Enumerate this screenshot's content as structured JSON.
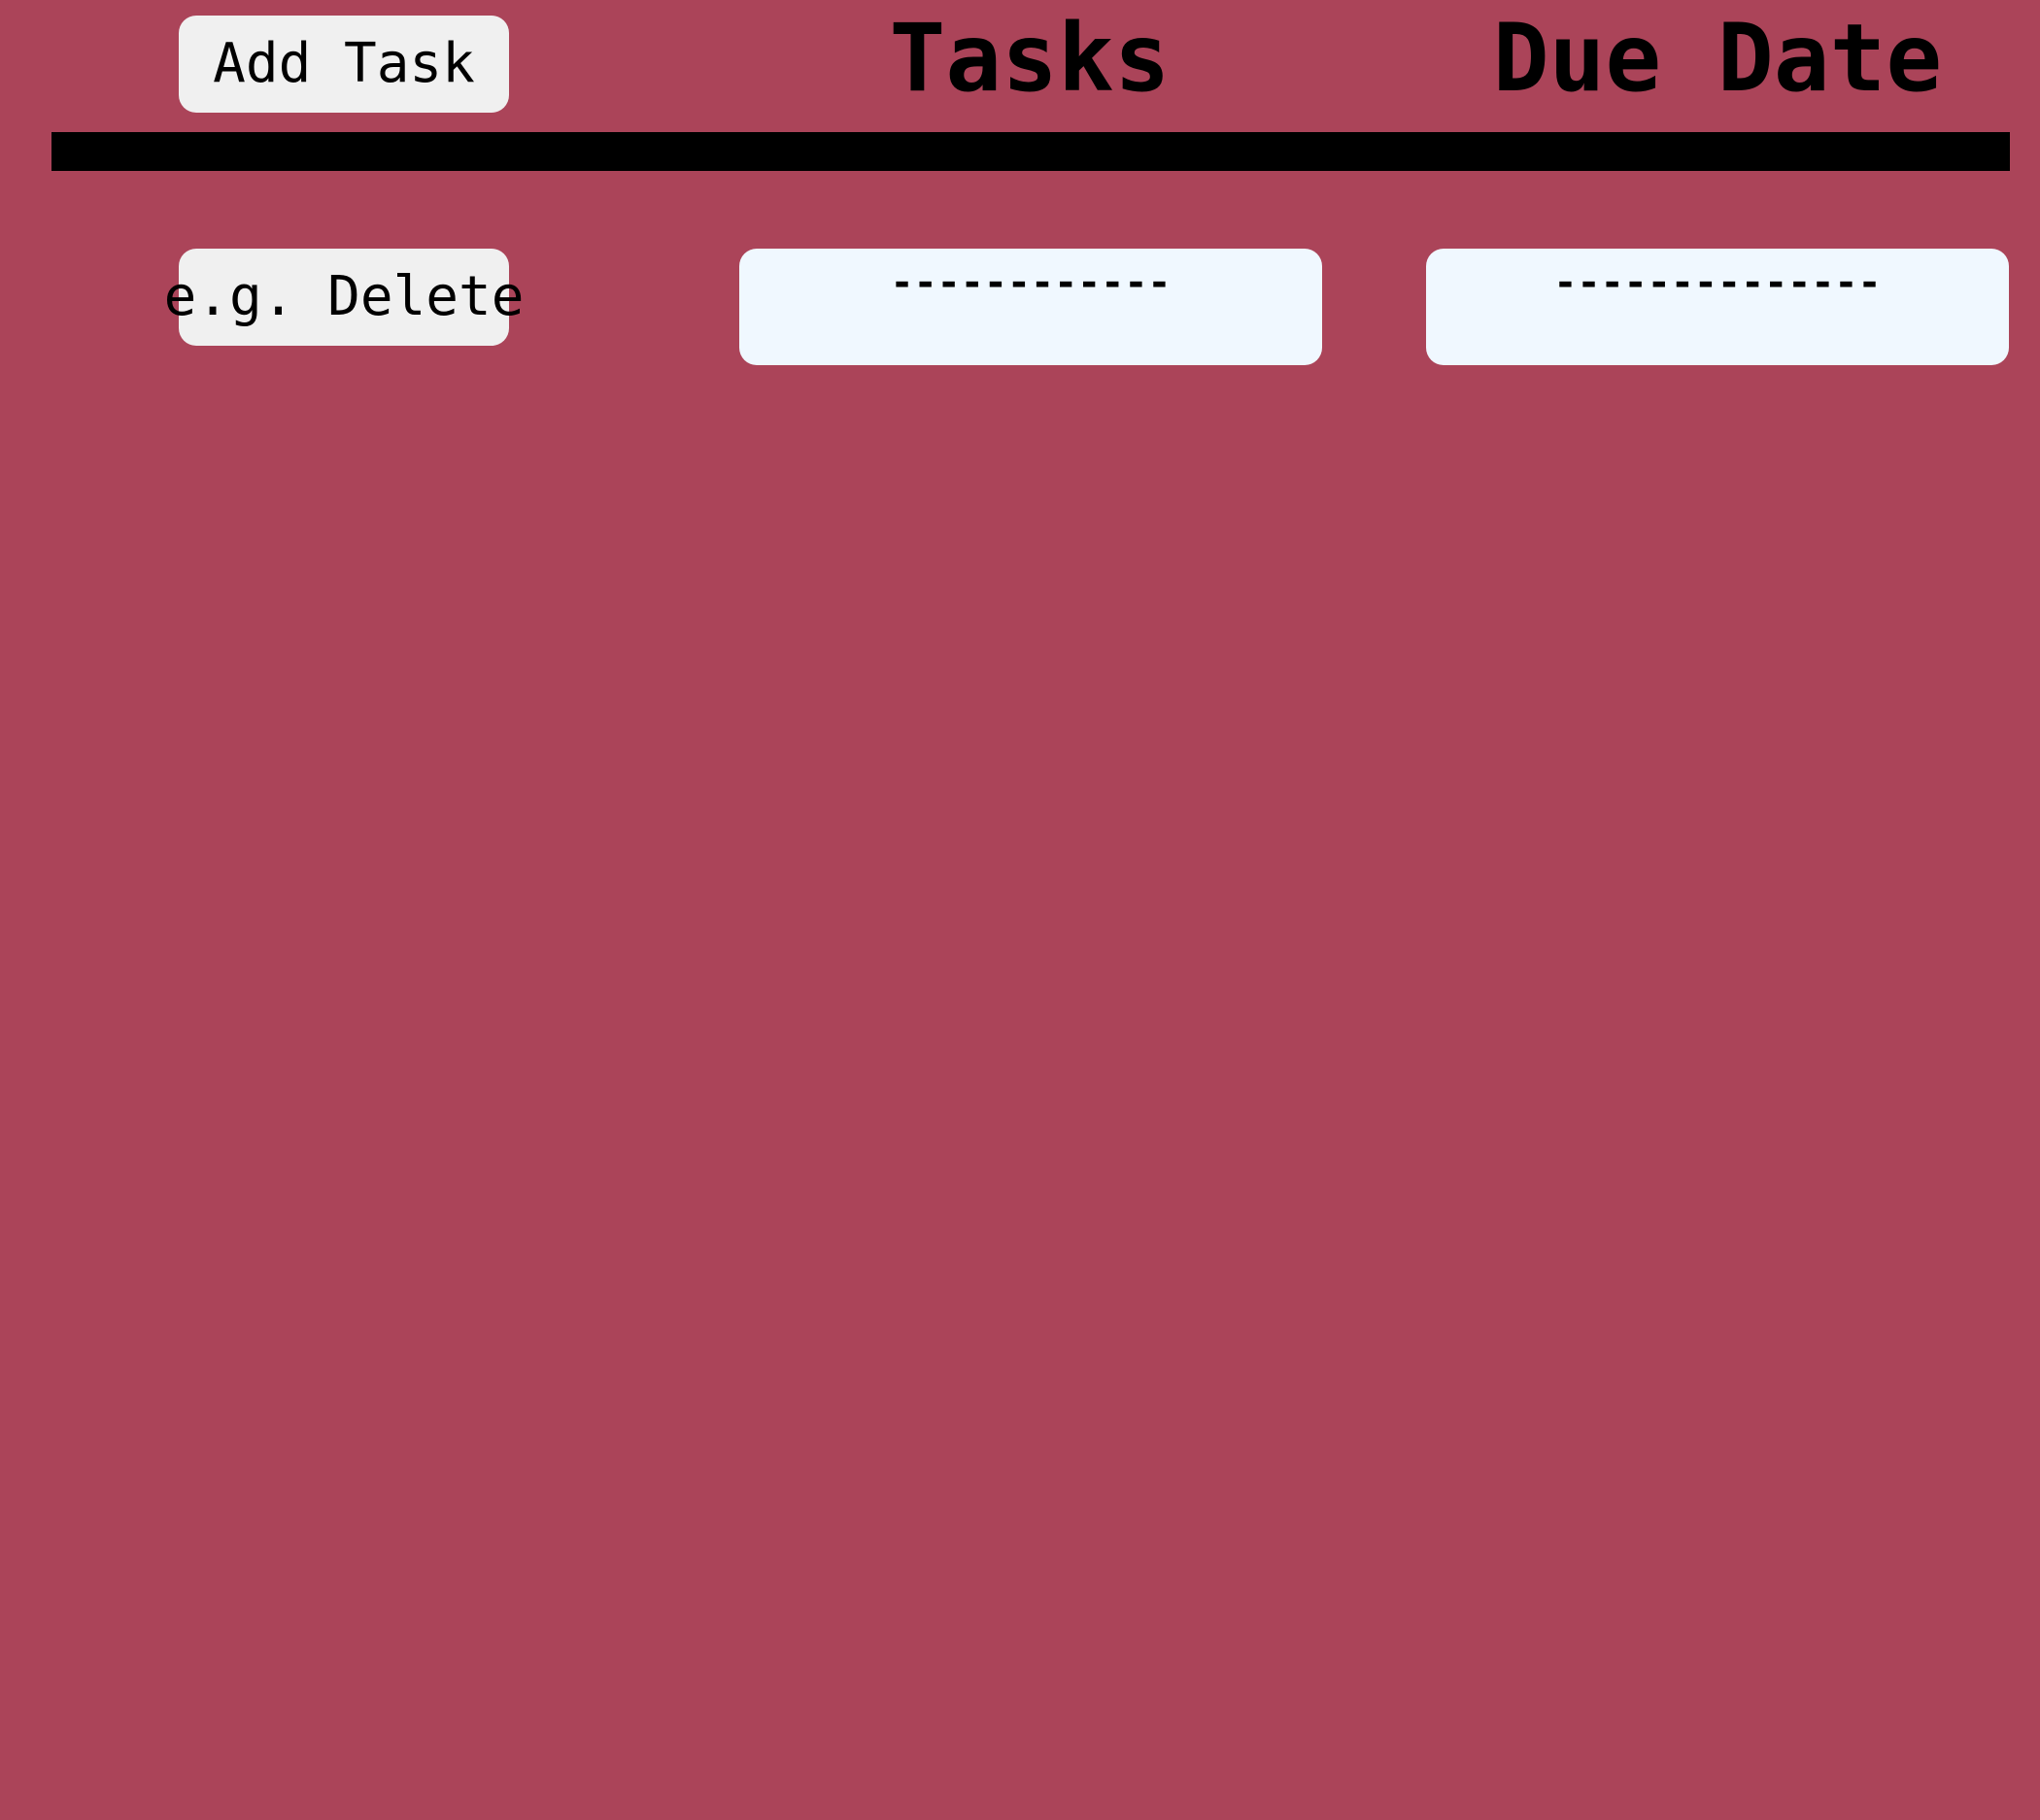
{
  "toolbar": {
    "add_label": "Add Task",
    "delete_label": "e.g. Delete"
  },
  "columns": {
    "tasks": "Tasks",
    "due_date": "Due Date"
  },
  "rows": [
    {
      "task": "------------",
      "due": "--------------"
    }
  ],
  "colors": {
    "background": "#ab4459",
    "button": "#f0f0f0",
    "cell": "#f0f8ff",
    "divider": "#000000"
  }
}
